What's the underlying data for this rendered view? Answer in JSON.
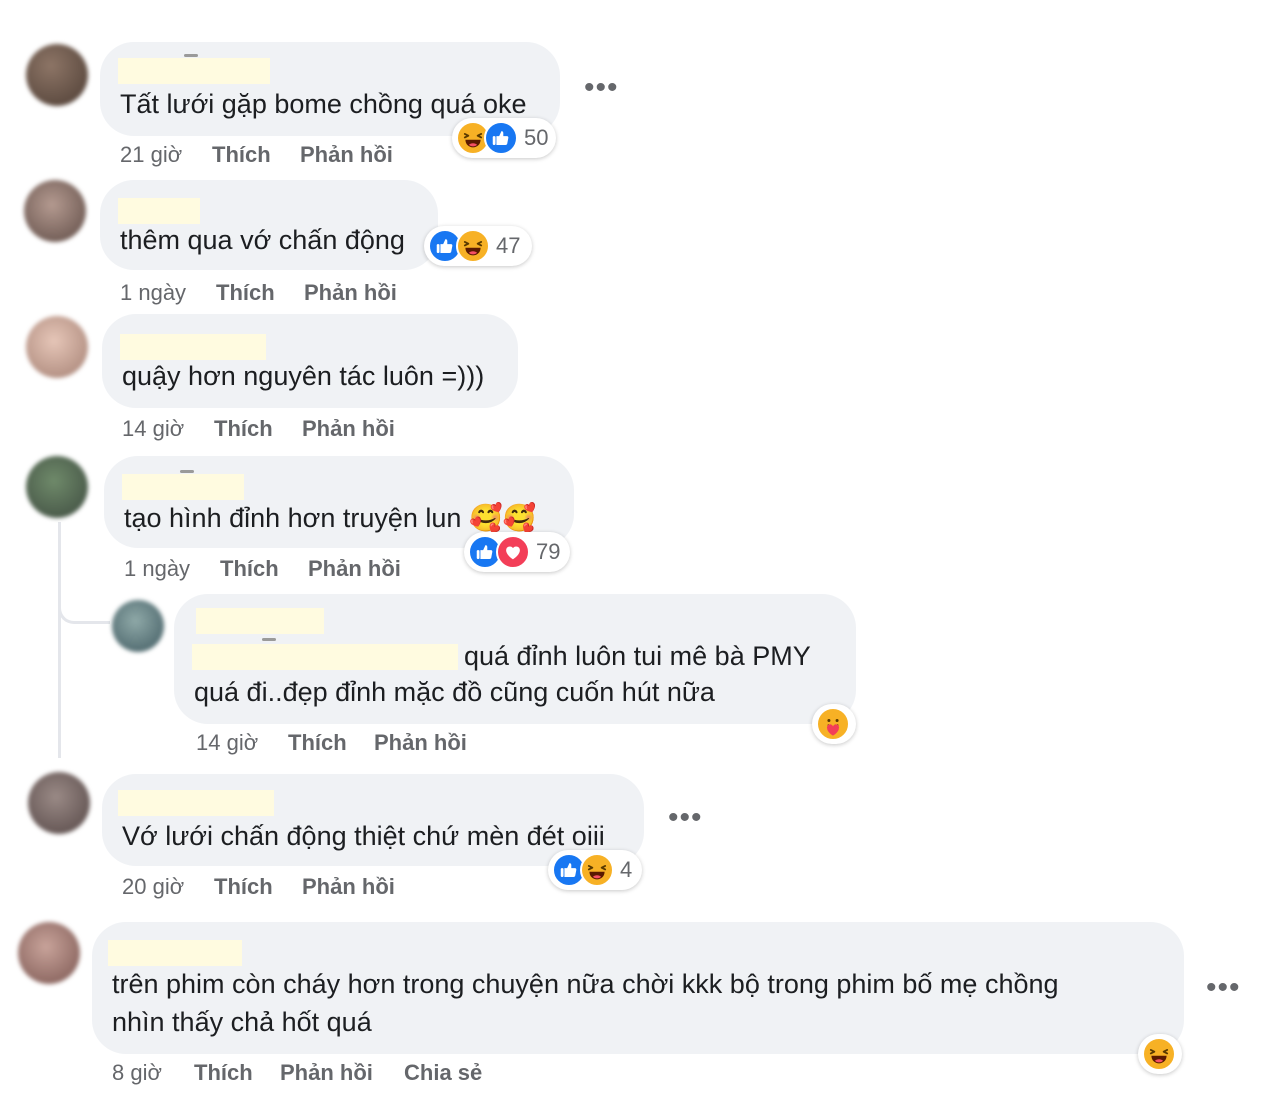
{
  "actions": {
    "like": "Thích",
    "reply": "Phản hồi",
    "share": "Chia sẻ"
  },
  "more_label": "•••",
  "colors": {
    "like_blue": "#1877f2",
    "haha_yellow": "#f7b125",
    "love_red": "#f33e58",
    "bubble_gray": "#f0f2f5",
    "meta_gray": "#65676b"
  },
  "comments": [
    {
      "text": "Tất lưới gặp bome chồng quá oke",
      "time": "21 giờ",
      "reactions": {
        "icons": [
          "haha-icon",
          "like-icon"
        ],
        "count": "50"
      }
    },
    {
      "text": "thêm qua vớ chấn động",
      "time": "1 ngày",
      "reactions": {
        "icons": [
          "like-icon",
          "haha-icon"
        ],
        "count": "47"
      }
    },
    {
      "text": "quậy hơn nguyên tác luôn =)))",
      "time": "14 giờ"
    },
    {
      "text": "tạo hình đỉnh hơn truyện lun 🥰🥰",
      "time": "1 ngày",
      "reactions": {
        "icons": [
          "like-icon",
          "love-icon"
        ],
        "count": "79"
      }
    },
    {
      "text_line1": "quá đỉnh luôn tui mê bà PMY",
      "text_line2": "quá đi..đẹp đỉnh mặc đồ cũng cuốn hút nữa",
      "time": "14 giờ",
      "reactions": {
        "icons": [
          "care-icon"
        ]
      }
    },
    {
      "text": "Vớ lưới chấn động thiệt chứ mèn đét oiii",
      "time": "20 giờ",
      "reactions": {
        "icons": [
          "like-icon",
          "haha-icon"
        ],
        "count": "4"
      }
    },
    {
      "text_line1": "trên phim còn cháy hơn trong chuyện nữa chời kkk bộ trong phim bố mẹ chồng",
      "text_line2": "nhìn thấy chả hốt quá",
      "time": "8 giờ",
      "reactions": {
        "icons": [
          "haha-icon"
        ]
      }
    }
  ]
}
